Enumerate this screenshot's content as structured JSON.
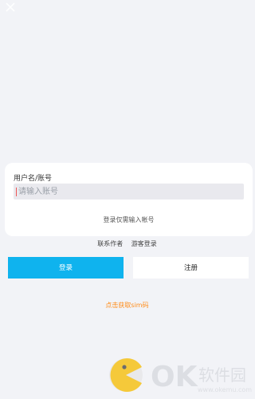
{
  "form": {
    "username_label": "用户名/账号",
    "username_placeholder": "请输入账号",
    "hint": "登录仅需输入帐号"
  },
  "links": {
    "contact_author": "联系作者",
    "guest_login": "游客登录"
  },
  "buttons": {
    "login": "登录",
    "register": "注册"
  },
  "sim_link": "点击获取sim码",
  "watermark": {
    "brand": "OK软件园",
    "url": "www.okemu.com"
  },
  "colors": {
    "login_button": "#0fb3ee",
    "sim_link": "#ff8c1a",
    "background": "#f2f3f7"
  }
}
